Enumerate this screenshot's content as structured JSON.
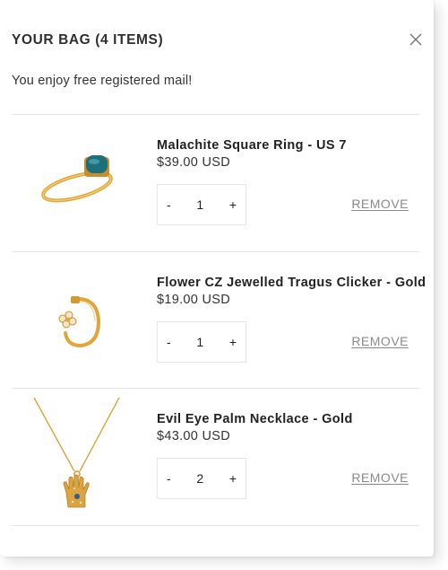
{
  "cart": {
    "title": "YOUR BAG (4 ITEMS)",
    "notice": "You enjoy free registered mail!",
    "items": [
      {
        "name": "Malachite Square Ring - US 7",
        "price": "$39.00 USD",
        "decrement": "-",
        "quantity": "1",
        "increment": "+",
        "remove": "REMOVE",
        "image": "gold-ring-malachite-image"
      },
      {
        "name": "Flower CZ Jewelled Tragus Clicker - Gold",
        "price": "$19.00 USD",
        "decrement": "-",
        "quantity": "1",
        "increment": "+",
        "remove": "REMOVE",
        "image": "gold-hoop-earring-image"
      },
      {
        "name": "Evil Eye Palm Necklace - Gold",
        "price": "$43.00 USD",
        "decrement": "-",
        "quantity": "2",
        "increment": "+",
        "remove": "REMOVE",
        "image": "gold-hamsa-necklace-image"
      }
    ]
  },
  "icons": {
    "close": "close-icon"
  },
  "colors": {
    "gold": "#e0a63b",
    "malachite": "#1d6f7c",
    "remove_text": "#8a8a8a",
    "divider": "#e3e3e3"
  }
}
